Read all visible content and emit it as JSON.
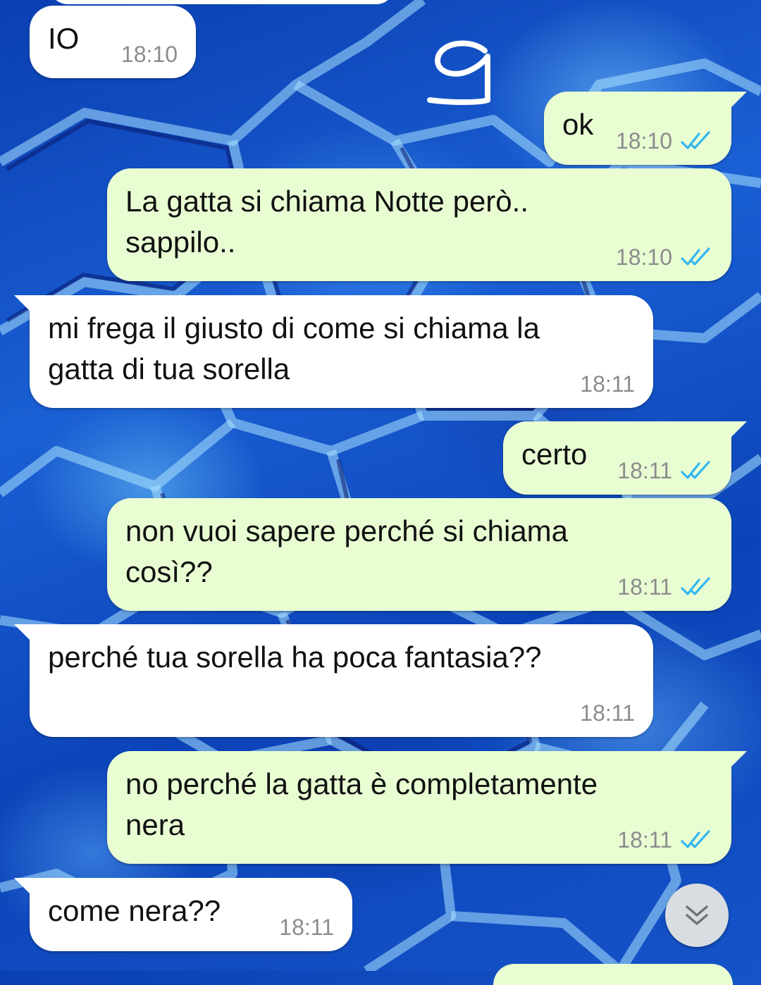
{
  "annotation": {
    "number": "9"
  },
  "messages": [
    {
      "id": "m1",
      "direction": "in",
      "lines": [
        "IO"
      ],
      "time": "18:10"
    },
    {
      "id": "m2",
      "direction": "out",
      "lines": [
        "ok"
      ],
      "time": "18:10",
      "status": "read"
    },
    {
      "id": "m3",
      "direction": "out",
      "lines": [
        "La gatta si chiama Notte però..",
        "sappilo.."
      ],
      "time": "18:10",
      "status": "read"
    },
    {
      "id": "m4",
      "direction": "in",
      "lines": [
        "mi frega il giusto di come si chiama la",
        "gatta di tua sorella"
      ],
      "time": "18:11"
    },
    {
      "id": "m5",
      "direction": "out",
      "lines": [
        "certo"
      ],
      "time": "18:11",
      "status": "read"
    },
    {
      "id": "m6",
      "direction": "out",
      "lines": [
        "non vuoi sapere perché si chiama",
        "così??"
      ],
      "time": "18:11",
      "status": "read"
    },
    {
      "id": "m7",
      "direction": "in",
      "lines": [
        "perché tua sorella ha poca fantasia??"
      ],
      "time": "18:11"
    },
    {
      "id": "m8",
      "direction": "out",
      "lines": [
        "no perché la gatta è completamente",
        "nera"
      ],
      "time": "18:11",
      "status": "read"
    },
    {
      "id": "m9",
      "direction": "in",
      "lines": [
        "come nera??"
      ],
      "time": "18:11"
    }
  ],
  "colors": {
    "incoming_bubble": "#ffffff",
    "outgoing_bubble": "#e9fdd3",
    "read_ticks": "#34b7f1",
    "timestamp": "#8c8c8c"
  },
  "icons": {
    "read_status": "double-check-icon",
    "scroll_down": "double-chevron-down-icon"
  }
}
